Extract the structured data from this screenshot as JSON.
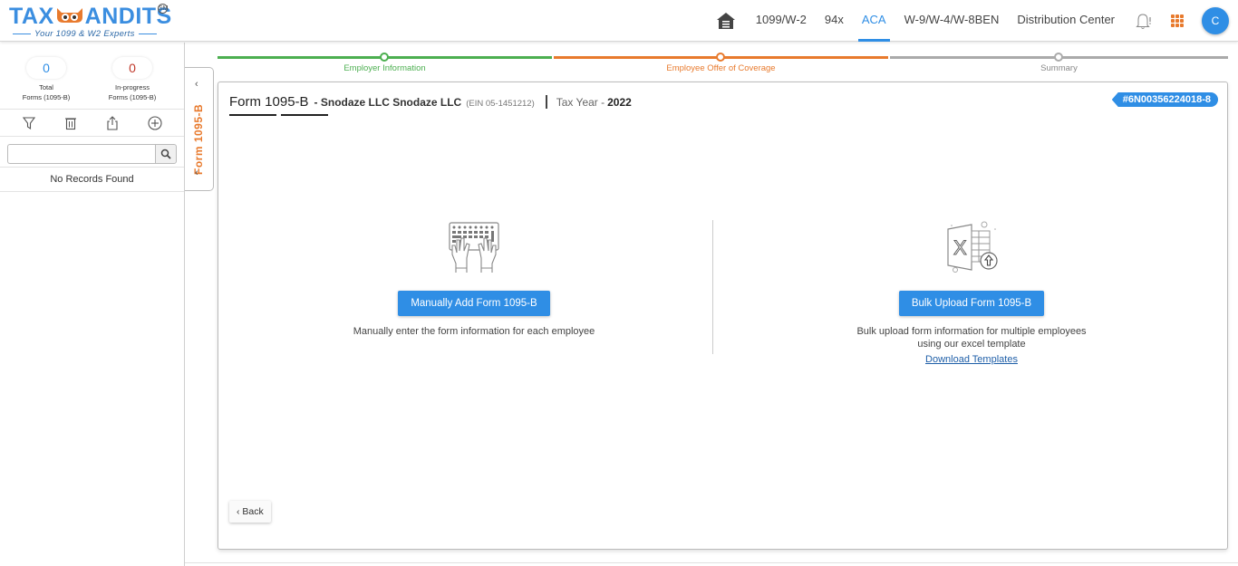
{
  "header": {
    "logo_text_left": "TAX",
    "logo_text_right": "ANDITS",
    "logo_trademark": "SM",
    "logo_tagline": "Your 1099 & W2 Experts",
    "nav": [
      {
        "label": "1099/W-2",
        "active": false
      },
      {
        "label": "94x",
        "active": false
      },
      {
        "label": "ACA",
        "active": true
      },
      {
        "label": "W-9/W-4/W-8BEN",
        "active": false
      },
      {
        "label": "Distribution Center",
        "active": false
      }
    ],
    "avatar_initial": "C"
  },
  "sidebar": {
    "total_count": "0",
    "total_label_1": "Total",
    "total_label_2": "Forms (1095-B)",
    "inprogress_count": "0",
    "inprogress_label_1": "In-progress",
    "inprogress_label_2": "Forms (1095-B)",
    "search_placeholder": "",
    "search_value": "",
    "no_records": "No Records Found",
    "vertical_tab_label": "Form 1095-B"
  },
  "stepper": {
    "steps": [
      {
        "label": "Employer Information",
        "status": "completed",
        "color": "#4caf50"
      },
      {
        "label": "Employee Offer of Coverage",
        "status": "current",
        "color": "#e87a2d"
      },
      {
        "label": "Summary",
        "status": "pending",
        "color": "#aaaaaa"
      }
    ]
  },
  "card": {
    "form_name": "Form 1095-B",
    "company": "- Snodaze LLC Snodaze LLC",
    "ein": "(EIN 05-1451212)",
    "tax_year_label": "Tax Year -",
    "tax_year": "2022",
    "ticket_id": "#6N00356224018-8",
    "manual": {
      "button": "Manually Add Form 1095-B",
      "description": "Manually enter the form information for each employee"
    },
    "bulk": {
      "button": "Bulk Upload Form 1095-B",
      "description_1": "Bulk upload form information for multiple employees",
      "description_2": "using our excel template",
      "link": "Download Templates"
    },
    "back_label": "Back"
  },
  "colors": {
    "primary": "#2f8ee5",
    "accent": "#e87a2d",
    "success": "#4caf50",
    "danger": "#c0392b"
  }
}
